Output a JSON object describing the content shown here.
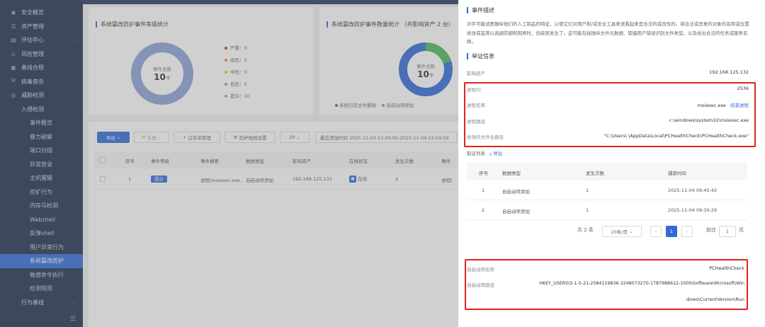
{
  "sidebar": {
    "items": [
      {
        "label": "安全概览",
        "icon": "dashboard-icon",
        "level": 0
      },
      {
        "label": "资产管理",
        "icon": "asset-icon",
        "level": 0
      },
      {
        "label": "评估中心",
        "icon": "document-icon",
        "level": 0
      },
      {
        "label": "风险管理",
        "icon": "warning-icon",
        "level": 0
      },
      {
        "label": "基线合规",
        "icon": "baseline-icon",
        "level": 0
      },
      {
        "label": "病毒查杀",
        "icon": "virus-icon",
        "level": 0
      },
      {
        "label": "威胁检测",
        "icon": "threat-icon",
        "level": 0
      },
      {
        "label": "入侵检测",
        "level": 1
      },
      {
        "label": "事件概览",
        "level": 2
      },
      {
        "label": "暴力破解",
        "level": 2
      },
      {
        "label": "端口扫描",
        "level": 2
      },
      {
        "label": "异常登录",
        "level": 2
      },
      {
        "label": "主机蜜罐",
        "level": 2
      },
      {
        "label": "挖矿行为",
        "level": 2
      },
      {
        "label": "内存马检测",
        "level": 2
      },
      {
        "label": "Webshell",
        "level": 2
      },
      {
        "label": "反弹shell",
        "level": 2
      },
      {
        "label": "用户异常行为",
        "level": 2
      },
      {
        "label": "系统篡改防护",
        "level": 2,
        "active": true
      },
      {
        "label": "敏感命令执行",
        "level": 2
      },
      {
        "label": "检测规则",
        "level": 2
      },
      {
        "label": "行为基线",
        "level": 1
      }
    ]
  },
  "stats": {
    "level_card": {
      "title": "系统篡改防护事件等级统计",
      "center_label": "事件总数",
      "center_value": "10",
      "center_unit": "个",
      "legend": [
        {
          "label": "严重：",
          "value": "0",
          "color": "#e0241a"
        },
        {
          "label": "高危：",
          "value": "0",
          "color": "#f07c2a"
        },
        {
          "label": "中危：",
          "value": "0",
          "color": "#f5b300"
        },
        {
          "label": "低危：",
          "value": "0",
          "color": "#7ab648"
        },
        {
          "label": "提示：",
          "value": "10",
          "color": "#8da2d8"
        }
      ]
    },
    "count_card": {
      "title": "系统篡改防护事件数量统计  （共影响资产 2 台）",
      "center_label": "事件总数",
      "center_value": "10",
      "center_unit": "个",
      "legend": [
        {
          "label": "系统日志文件删除",
          "color": "#2f6ad9"
        },
        {
          "label": "自启动项添加",
          "color": "#4cb860"
        }
      ]
    }
  },
  "toolbar": {
    "export": "导出",
    "handle": "处理",
    "whitelist": "白名单管理",
    "rule_settings": "防护规则设置",
    "page_size": "20",
    "time_range": "最近添加时间 2025-11-03 23:00:00-2025-11-04 23:59:59"
  },
  "table": {
    "headers": [
      "序号",
      "事件等级",
      "事件摘要",
      "数据类型",
      "影响资产",
      "在线状态",
      "发生次数",
      "事件"
    ],
    "rows": [
      {
        "index": "1",
        "level": "提示",
        "summary": "进程[msiexec.exe...",
        "type": "自启动项添加",
        "asset": "192.168.125.132",
        "online": "在线",
        "count": "2",
        "event": "进程["
      }
    ]
  },
  "panel": {
    "event_desc_title": "事件描述",
    "event_desc": "对手可能试图操纵他们的人工制品的特征，以使它们对用户和/或安全工具来说看起来是合法的或良性的。将合法或恶意的对象的名称或位置修改或滥用以逃避防御和观察时，伪装就发生了。这可能包括操纵文件元数据、欺骗用户错误识别文件类型，以及给出合法的任务或服务名称。",
    "evidence_title": "举证信息",
    "asset_label": "影响资产",
    "asset_value": "192.168.125.132",
    "pid_label": "进程ID",
    "pid_value": "2536",
    "pname_label": "进程名称",
    "pname_value": "msiexec.exe",
    "end_process": "结束进程",
    "ppath_label": "进程路径",
    "ppath_value": "c:\\windows\\system32\\msiexec.exe",
    "modfile_label": "修改的文件全路径",
    "modfile_value": "\"C:\\Users\\      \\AppData\\Local\\PCHealthCheck\\PCHealthCheck.exe\"",
    "evidence_list": "取证列表",
    "export": "导出",
    "sub_headers": [
      "序号",
      "数据类型",
      "发生次数",
      "捕获时间"
    ],
    "sub_rows": [
      {
        "index": "1",
        "type": "自启动项添加",
        "count": "1",
        "time": "2025-11-04 09:45:42"
      },
      {
        "index": "2",
        "type": "自启动项添加",
        "count": "1",
        "time": "2025-11-04 09:30:29"
      }
    ],
    "total": "共 2 条",
    "per_page": "20条/页",
    "current_page": "1",
    "goto": "前往",
    "goto_page": "1",
    "page_unit": "页",
    "autorun_name_label": "自启动项名称",
    "autorun_name_value": "PCHealthCheck",
    "autorun_path_label": "自启动项路径",
    "autorun_path_line1": "HKEY_USERS\\S-1-5-21-2584119836-3248073270-1787988612-1000\\Software\\Microsoft\\Win",
    "autorun_path_line2": "dows\\CurrentVersion\\Run"
  }
}
